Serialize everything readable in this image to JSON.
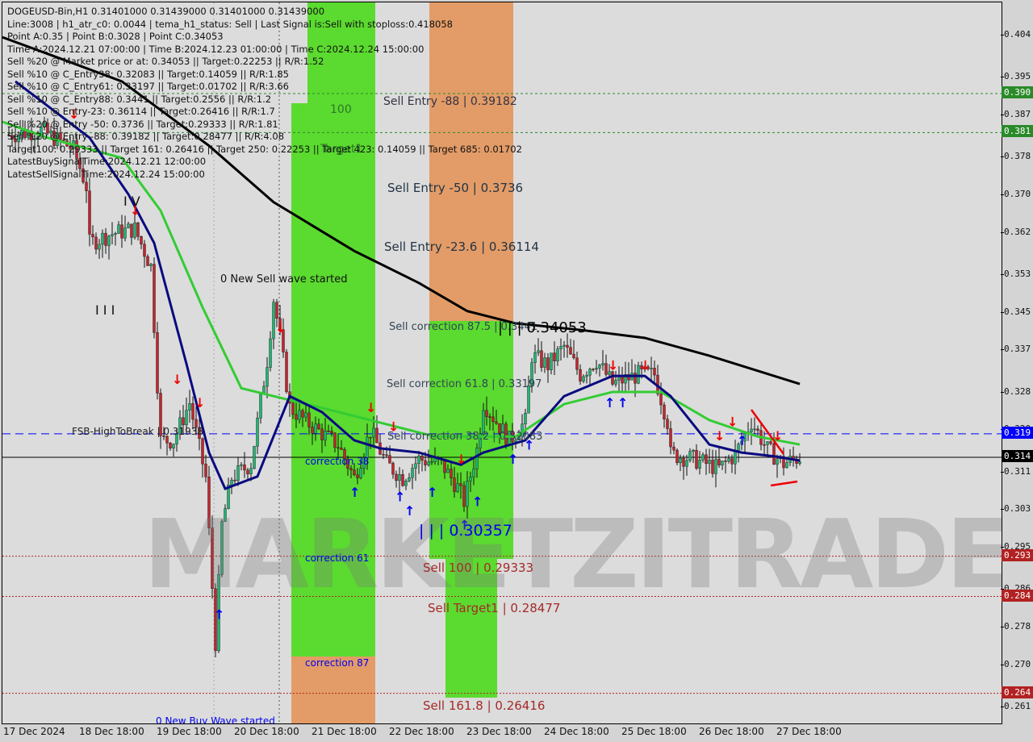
{
  "window": {
    "title": "DOGEUSD-Bin,H1"
  },
  "info_lines": [
    "DOGEUSD-Bin,H1  0.31401000 0.31439000 0.31401000 0.31439000",
    "Line:3008 | h1_atr_c0: 0.0044 | tema_h1_status: Sell | Last Signal is:Sell with stoploss:0.418058",
    "Point A:0.35 | Point B:0.3028 | Point C:0.34053",
    "Time A:2024.12.21 07:00:00 | Time B:2024.12.23 01:00:00 | Time C:2024.12.24 15:00:00",
    "Sell %20 @ Market price or at: 0.34053 || Target:0.22253 || R/R:1.52",
    "Sell %10 @ C_Entry38: 0.32083 || Target:0.14059 || R/R:1.85",
    "Sell %10 @ C_Entry61: 0.33197 || Target:0.01702 || R/R:3.66",
    "Sell %10 @ C_Entry88: 0.3441 || Target:0.2556 || R/R:1.2",
    "Sell %10 @ Entry-23: 0.36114 || Target:0.26416 || R/R:1.7",
    "Sell %20 @ Entry -50: 0.3736 || Target:0.29333 || R/R:1.81",
    "Sell %20 @ Entry -88: 0.39182 || Target:0.28477 || R/R:4.08",
    "Target100: 0.29333 || Target 161: 0.26416 || Target 250: 0.22253 || Target 423: 0.14059 || Target 685: 0.01702",
    "LatestBuySignalTime:2024.12.21 12:00:00",
    "LatestSellSignalTime:2024.12.24 15:00:00"
  ],
  "chart_labels": {
    "sell_entry_88": "Sell Entry -88 | 0.39182",
    "band_100": "100",
    "target1": "Target1",
    "sell_entry_50": "Sell Entry -50 | 0.3736",
    "sell_entry_23": "Sell Entry -23.6 | 0.36114",
    "new_sell_wave": "0 New Sell wave started",
    "sell_corr_875": "Sell correction 87.5 | 0.3441",
    "point_c": "| | | 0.34053",
    "sell_corr_618": "Sell correction 61.8 | 0.33197",
    "fsb": "FSB-HighToBreak | 0.31938",
    "sell_corr_382": "Sell correction 38.2 | 0.32083",
    "correction_38": "correction 38",
    "point_b": "| | | 0.30357",
    "correction_61": "correction 61",
    "sell_100": "Sell 100 | 0.29333",
    "sell_target1": "Sell Target1 | 0.28477",
    "correction_87": "correction 87",
    "sell_1618": "Sell 161.8 | 0.26416",
    "new_buy_wave": "0 New Buy Wave started",
    "wave_iv": "I V",
    "wave_iii": "I I I"
  },
  "watermark": "MARKETZITRADE",
  "colors": {
    "bull": "#22b573",
    "bear": "#c0262d",
    "ma200": "#000000",
    "ma_green": "#33cc33",
    "ma_blue": "#0a0a80",
    "band_green": "#4cd91c",
    "band_orange": "#e3955a",
    "level_red": "#b22222",
    "level_green": "#2a8a2a",
    "accent_blue": "#0000ff"
  },
  "chart_data": {
    "type": "candlestick",
    "symbol": "DOGEUSD-Bin",
    "timeframe": "H1",
    "ylim": [
      0.2588,
      0.4104
    ],
    "y_ticks": [
      "0.404",
      "0.395",
      "0.387",
      "0.378",
      "0.370",
      "0.362",
      "0.353",
      "0.345",
      "0.337",
      "0.328",
      "0.320",
      "0.311",
      "0.303",
      "0.295",
      "0.286",
      "0.278",
      "0.270",
      "0.261"
    ],
    "x_ticks": [
      "17 Dec 2024",
      "18 Dec 18:00",
      "19 Dec 18:00",
      "20 Dec 18:00",
      "21 Dec 18:00",
      "22 Dec 18:00",
      "23 Dec 18:00",
      "24 Dec 18:00",
      "25 Dec 18:00",
      "26 Dec 18:00",
      "27 Dec 18:00"
    ],
    "price_path": [
      [
        "12-17 20",
        0.383
      ],
      [
        "12-18 06",
        0.384
      ],
      [
        "12-18 16",
        0.38
      ],
      [
        "12-18 20",
        0.372
      ],
      [
        "12-18 21",
        0.36
      ],
      [
        "12-19 04",
        0.362
      ],
      [
        "12-19 11",
        0.363
      ],
      [
        "12-19 16",
        0.355
      ],
      [
        "12-19 18",
        0.33
      ],
      [
        "12-19 19",
        0.318
      ],
      [
        "12-19 23",
        0.318
      ],
      [
        "12-20 04",
        0.326
      ],
      [
        "12-20 09",
        0.31
      ],
      [
        "12-20 12",
        0.275
      ],
      [
        "12-20 14",
        0.3
      ],
      [
        "12-20 17",
        0.31
      ],
      [
        "12-20 23",
        0.313
      ],
      [
        "12-21 04",
        0.335
      ],
      [
        "12-21 06",
        0.348
      ],
      [
        "12-21 08",
        0.34
      ],
      [
        "12-21 11",
        0.325
      ],
      [
        "12-21 16",
        0.322
      ],
      [
        "12-22 02",
        0.317
      ],
      [
        "12-22 07",
        0.31
      ],
      [
        "12-22 12",
        0.32
      ],
      [
        "12-22 17",
        0.313
      ],
      [
        "12-22 22",
        0.31
      ],
      [
        "12-23 03",
        0.314
      ],
      [
        "12-23 10",
        0.313
      ],
      [
        "12-23 15",
        0.308
      ],
      [
        "12-23 17",
        0.305
      ],
      [
        "12-23 21",
        0.316
      ],
      [
        "12-23 23",
        0.326
      ],
      [
        "12-24 07",
        0.318
      ],
      [
        "12-24 12",
        0.322
      ],
      [
        "12-24 14",
        0.336
      ],
      [
        "12-24 19",
        0.334
      ],
      [
        "12-25 00",
        0.338
      ],
      [
        "12-25 05",
        0.332
      ],
      [
        "12-25 10",
        0.335
      ],
      [
        "12-25 15",
        0.33
      ],
      [
        "12-25 23",
        0.332
      ],
      [
        "12-26 04",
        0.332
      ],
      [
        "12-26 08",
        0.322
      ],
      [
        "12-26 09",
        0.315
      ],
      [
        "12-26 16",
        0.314
      ],
      [
        "12-27 00",
        0.312
      ],
      [
        "12-27 05",
        0.315
      ],
      [
        "12-27 10",
        0.322
      ],
      [
        "12-27 15",
        0.316
      ],
      [
        "12-27 20",
        0.313
      ],
      [
        "12-28 01",
        0.31439
      ]
    ],
    "ma_black": [
      [
        "12-17 18",
        0.4038
      ],
      [
        "12-18 11",
        0.3995
      ],
      [
        "12-19 07",
        0.3944
      ],
      [
        "12-20 10",
        0.3807
      ],
      [
        "12-21 06",
        0.3687
      ],
      [
        "12-22 07",
        0.3583
      ],
      [
        "12-23 03",
        0.3515
      ],
      [
        "12-23 18",
        0.3455
      ],
      [
        "12-24 09",
        0.3429
      ],
      [
        "12-25 05",
        0.3415
      ],
      [
        "12-26 01",
        0.3398
      ],
      [
        "12-26 21",
        0.336
      ],
      [
        "12-28 01",
        0.33
      ]
    ],
    "ma_green": [
      [
        "12-17 18",
        0.3858
      ],
      [
        "12-18 08",
        0.3824
      ],
      [
        "12-19 07",
        0.3781
      ],
      [
        "12-19 19",
        0.3669
      ],
      [
        "12-20 08",
        0.3463
      ],
      [
        "12-20 20",
        0.3291
      ],
      [
        "12-21 06",
        0.3274
      ],
      [
        "12-21 21",
        0.3249
      ],
      [
        "12-22 12",
        0.3223
      ],
      [
        "12-23 08",
        0.3188
      ],
      [
        "12-24 09",
        0.3188
      ],
      [
        "12-25 00",
        0.3257
      ],
      [
        "12-25 15",
        0.3283
      ],
      [
        "12-26 06",
        0.3283
      ],
      [
        "12-26 21",
        0.3223
      ],
      [
        "12-27 12",
        0.3188
      ],
      [
        "12-28 01",
        0.3171
      ]
    ],
    "ma_blue": [
      [
        "12-17 22",
        0.3944
      ],
      [
        "12-18 21",
        0.3824
      ],
      [
        "12-19 09",
        0.3704
      ],
      [
        "12-19 17",
        0.36
      ],
      [
        "12-20 03",
        0.3343
      ],
      [
        "12-20 10",
        0.3154
      ],
      [
        "12-20 15",
        0.3077
      ],
      [
        "12-21 01",
        0.3103
      ],
      [
        "12-21 11",
        0.3274
      ],
      [
        "12-21 21",
        0.324
      ],
      [
        "12-22 07",
        0.318
      ],
      [
        "12-22 15",
        0.3163
      ],
      [
        "12-23 03",
        0.3154
      ],
      [
        "12-23 16",
        0.3128
      ],
      [
        "12-23 23",
        0.3154
      ],
      [
        "12-24 12",
        0.318
      ],
      [
        "12-25 00",
        0.3274
      ],
      [
        "12-25 15",
        0.3317
      ],
      [
        "12-26 01",
        0.3317
      ],
      [
        "12-26 09",
        0.3274
      ],
      [
        "12-26 21",
        0.3171
      ],
      [
        "12-27 07",
        0.3154
      ],
      [
        "12-27 17",
        0.3146
      ],
      [
        "12-28 01",
        0.3137
      ]
    ],
    "levels": [
      {
        "price": 0.39182,
        "label": "0.390",
        "color": "#2a8a2a",
        "style": "dashed"
      },
      {
        "price": 0.3835,
        "label": "0.381",
        "color": "#2a8a2a",
        "style": "dashed"
      },
      {
        "price": 0.31938,
        "label": "0.319",
        "color": "#0000ff",
        "style": "longdash"
      },
      {
        "price": 0.31439,
        "label": "0.314",
        "color": "#000000",
        "style": "solid"
      },
      {
        "price": 0.29333,
        "label": "0.293",
        "color": "#b22222",
        "style": "dotted"
      },
      {
        "price": 0.28477,
        "label": "0.284",
        "color": "#b22222",
        "style": "dotted"
      },
      {
        "price": 0.26416,
        "label": "0.264",
        "color": "#b22222",
        "style": "dotted"
      }
    ],
    "sell_signals": [
      [
        "12-18 16",
        0.3865
      ],
      [
        "12-19 11",
        0.366
      ],
      [
        "12-20 00",
        0.33
      ],
      [
        "12-20 07",
        0.325
      ],
      [
        "12-21 08",
        0.341
      ],
      [
        "12-22 12",
        0.324
      ],
      [
        "12-22 19",
        0.32
      ],
      [
        "12-23 16",
        0.313
      ],
      [
        "12-25 15",
        0.333
      ],
      [
        "12-26 01",
        0.333
      ],
      [
        "12-27 00",
        0.318
      ],
      [
        "12-27 04",
        0.321
      ],
      [
        "12-27 18",
        0.318
      ]
    ],
    "buy_signals": [
      [
        "12-20 13",
        0.28
      ],
      [
        "12-22 07",
        0.306
      ],
      [
        "12-22 21",
        0.305
      ],
      [
        "12-23 00",
        0.302
      ],
      [
        "12-23 07",
        0.306
      ],
      [
        "12-23 17",
        0.299
      ],
      [
        "12-23 21",
        0.304
      ],
      [
        "12-24 08",
        0.313
      ],
      [
        "12-24 13",
        0.316
      ],
      [
        "12-25 14",
        0.325
      ],
      [
        "12-25 18",
        0.325
      ],
      [
        "12-27 07",
        0.317
      ]
    ]
  }
}
